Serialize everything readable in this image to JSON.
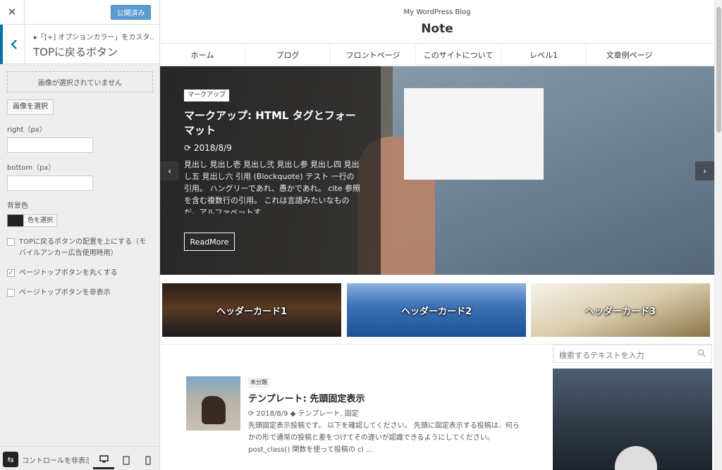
{
  "customizer": {
    "close_icon": "close-icon",
    "publish_label": "公開済み",
    "breadcrumb": "▸「[+] オプションカラー」をカスタ…",
    "panel_title": "TOPに戻るボタン",
    "no_image_label": "画像が選択されていません",
    "select_image_label": "画像を選択",
    "right_label": "right（px）",
    "right_value": "",
    "bottom_label": "bottom（px）",
    "bottom_value": "",
    "bg_color_label": "背景色",
    "bg_color_value": "#222222",
    "select_color_label": "色を選択",
    "options": [
      {
        "label": "TOPに戻るボタンの配置を上にする（モバイルアンカー広告使用時用）",
        "checked": false
      },
      {
        "label": "ページトップボタンを丸くする",
        "checked": true
      },
      {
        "label": "ページトップボタンを非表示",
        "checked": false
      }
    ],
    "collapse_label": "コントロールを非表示",
    "devices": [
      "desktop",
      "tablet",
      "mobile"
    ],
    "active_device": "desktop"
  },
  "site": {
    "description": "My WordPress Blog",
    "title": "Note",
    "nav": [
      "ホーム",
      "ブログ",
      "フロントページ",
      "このサイトについて",
      "レベル1",
      "文章例ページ"
    ]
  },
  "hero": {
    "tag": "マークアップ",
    "title": "マークアップ: HTML タグとフォーマット",
    "date": "⟳ 2018/8/9",
    "excerpt": "見出し 見出し壱 見出し弐 見出し参 見出し四 見出し五 見出し六 引用 (Blockquote) テスト 一行の引用。 ハングリーであれ、愚かであれ。 cite 参照を含む複数行の引用。 これは言語みたいなものだ。アルファベットす",
    "readmore": "ReadMore",
    "prev": "‹",
    "next": "›"
  },
  "header_cards": [
    "ヘッダーカード1",
    "ヘッダーカード2",
    "ヘッダーカード3"
  ],
  "search": {
    "placeholder": "検索するテキストを入力"
  },
  "post": {
    "category": "未分類",
    "title": "テンプレート: 先頭固定表示",
    "meta": "⟳ 2018/8/9  ◆ テンプレート, 固定",
    "excerpt": "先頭固定表示投稿です。 以下を確認してください。 先頭に固定表示する投稿は、何らかの形で通常の投稿と差をつけてその違いが認識できるようにしてください。 post_class() 関数を使って投稿の cl …"
  },
  "colors": {
    "publish": "#5a9bd0",
    "accent": "#0073aa"
  }
}
